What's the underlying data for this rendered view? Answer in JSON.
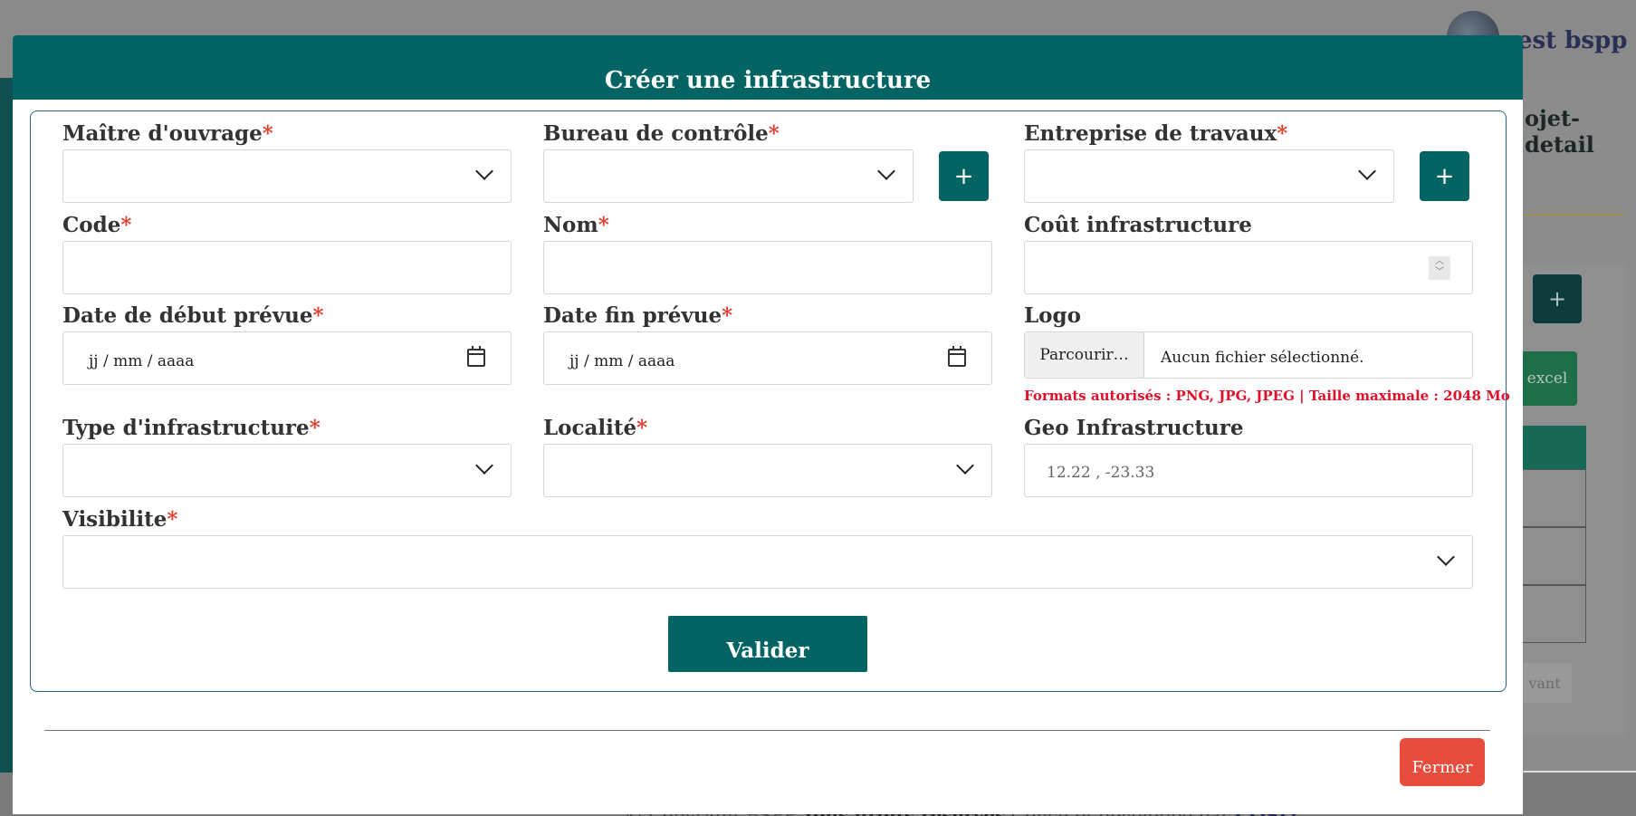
{
  "background": {
    "user_name": "est bspp",
    "detail_title": "ojet-detail",
    "excel_label": "excel",
    "next_label": "vant",
    "plus_label": "+",
    "footer": {
      "copyright": "© Copyright BSPP",
      "rights": "Tous droits réservés",
      "designed": "Conçu et développé par",
      "company": "COSIT"
    }
  },
  "modal": {
    "title": "Créer une infrastructure",
    "required_mark": "*",
    "fields": {
      "maitre_ouvrage": {
        "label": "Maître d'ouvrage",
        "value": ""
      },
      "bureau_controle": {
        "label": "Bureau de contrôle",
        "value": ""
      },
      "entreprise_travaux": {
        "label": "Entreprise de travaux",
        "value": ""
      },
      "code": {
        "label": "Code",
        "value": ""
      },
      "nom": {
        "label": "Nom",
        "value": ""
      },
      "cout": {
        "label": "Coût infrastructure",
        "value": ""
      },
      "date_debut": {
        "label": "Date de début prévue",
        "placeholder": "jj / mm / aaaa"
      },
      "date_fin": {
        "label": "Date fin prévue",
        "placeholder": "jj / mm / aaaa"
      },
      "logo": {
        "label": "Logo",
        "button": "Parcourir…",
        "status": "Aucun fichier sélectionné.",
        "hint": "Formats autorisés : PNG, JPG, JPEG | Taille maximale : 2048 Mo"
      },
      "type_infrastructure": {
        "label": "Type d'infrastructure",
        "value": ""
      },
      "localite": {
        "label": "Localité",
        "value": ""
      },
      "geo": {
        "label": "Geo Infrastructure",
        "placeholder": "12.22 , -23.33"
      },
      "visibilite": {
        "label": "Visibilite",
        "value": ""
      }
    },
    "add_button_label": "+",
    "submit_label": "Valider",
    "close_label": "Fermer"
  },
  "colors": {
    "primary": "#046464",
    "danger": "#e84c3d",
    "required": "#e03d2c"
  },
  "icons": {
    "menu": "chevron-down-icon",
    "calendar": "calendar-icon",
    "select": "chevron-down-icon"
  }
}
